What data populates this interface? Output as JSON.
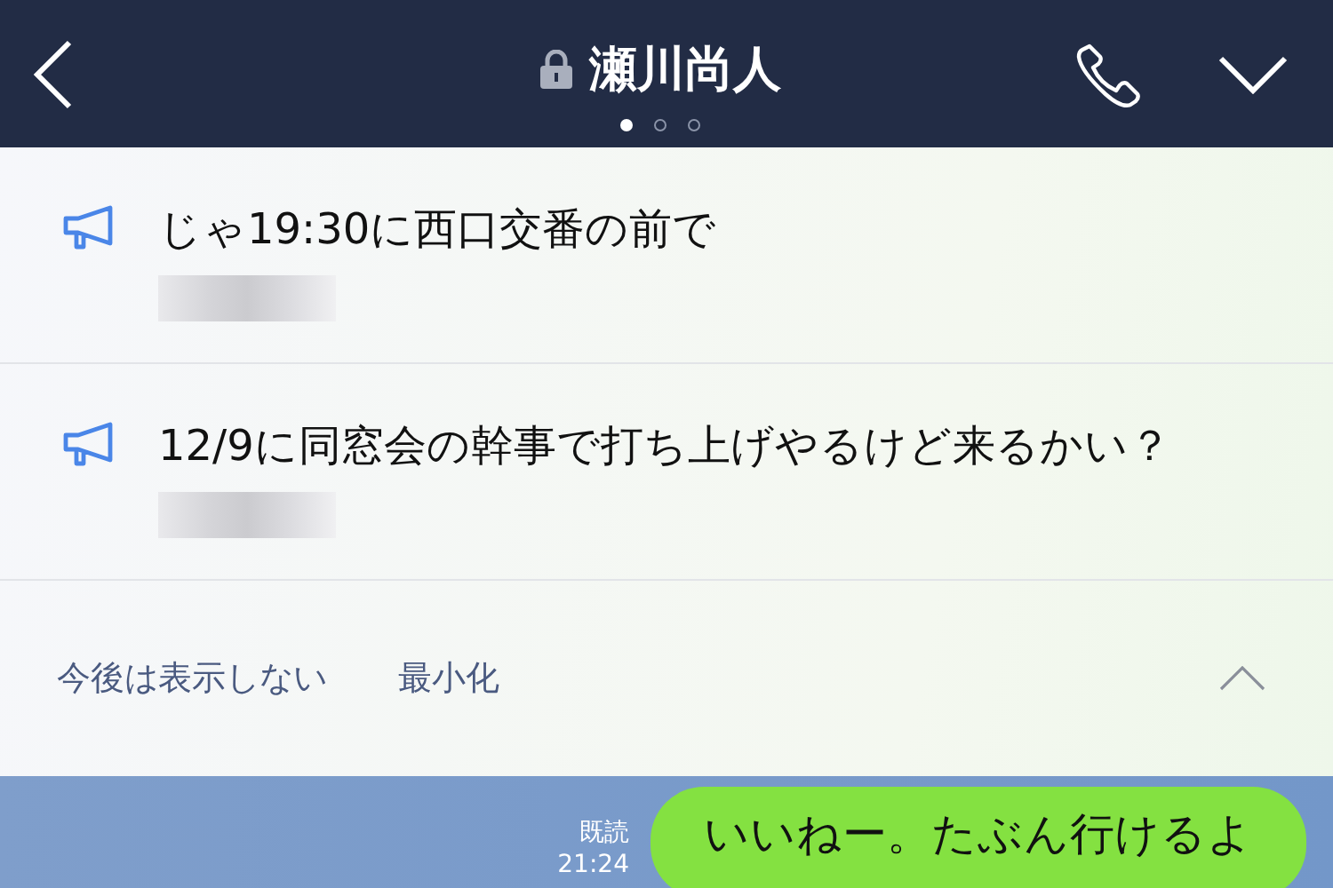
{
  "header": {
    "title": "瀬川尚人",
    "locked": true,
    "pages": [
      {
        "selected": true
      },
      {
        "selected": false
      },
      {
        "selected": false
      }
    ]
  },
  "announcements": {
    "items": [
      {
        "text": "じゃ19:30に西口交番の前で"
      },
      {
        "text": "12/9に同窓会の幹事で打ち上げやるけど来るかい？"
      }
    ],
    "actions": [
      "今後は表示しない",
      "最小化"
    ]
  },
  "messages": [
    {
      "kind": "sent",
      "text": "いいねー。たぶん行けるよ",
      "read": "既読",
      "time": "21:24"
    }
  ]
}
